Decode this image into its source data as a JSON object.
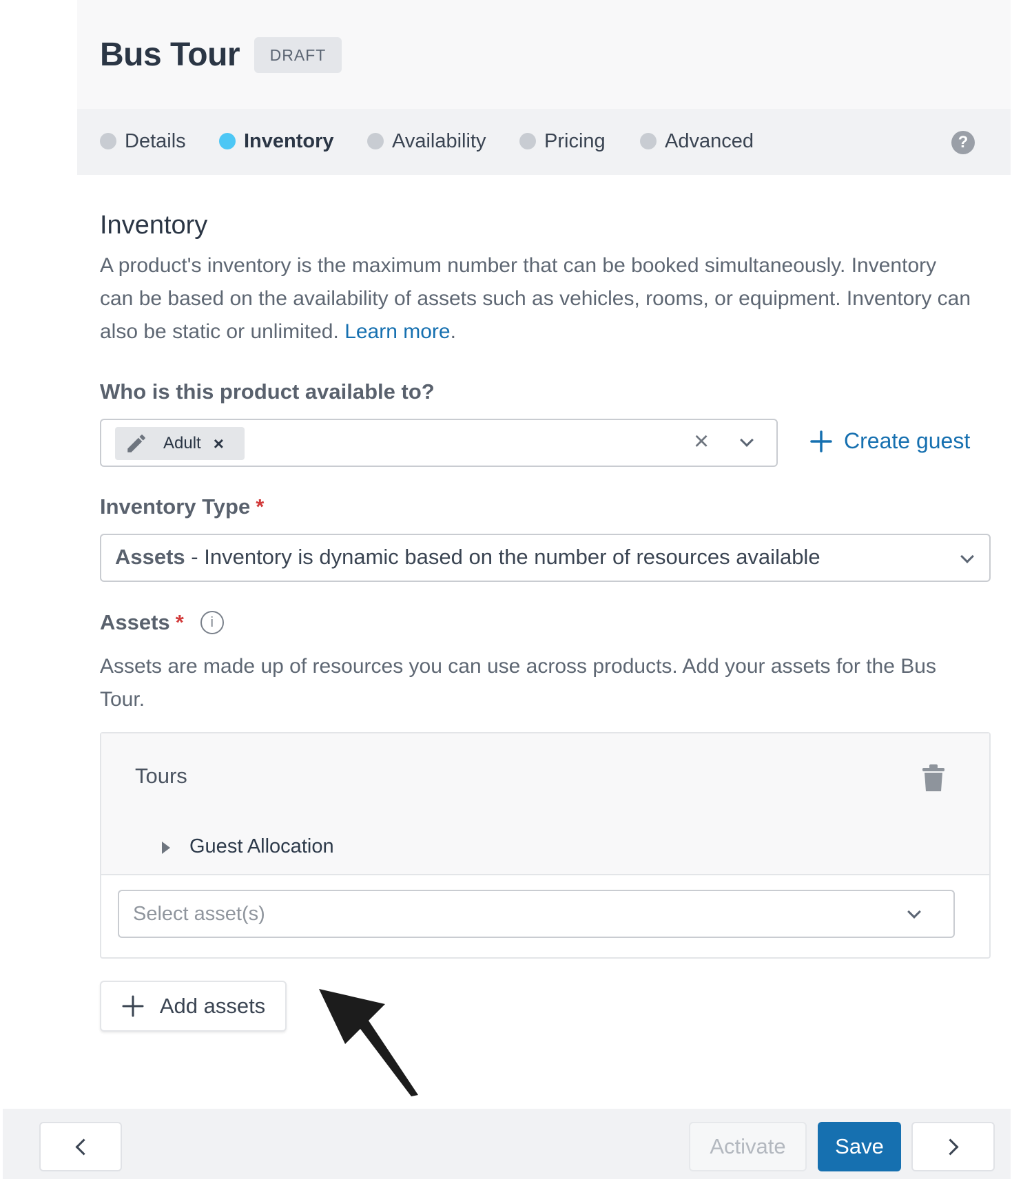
{
  "header": {
    "title": "Bus Tour",
    "status_badge": "DRAFT"
  },
  "tabs": [
    {
      "label": "Details",
      "active": false
    },
    {
      "label": "Inventory",
      "active": true
    },
    {
      "label": "Availability",
      "active": false
    },
    {
      "label": "Pricing",
      "active": false
    },
    {
      "label": "Advanced",
      "active": false
    }
  ],
  "help_icon": "?",
  "inventory": {
    "title": "Inventory",
    "description": "A product's inventory is the maximum number that can be booked simultaneously. Inventory can be based on the availability of assets such as vehicles, rooms, or equipment. Inventory can also be static or unlimited.",
    "learn_more": "Learn more",
    "period": "."
  },
  "availability": {
    "label": "Who is this product available to?",
    "chip": "Adult",
    "chip_remove": "×",
    "clear": "×",
    "create_guest": "Create guest"
  },
  "inventory_type": {
    "label": "Inventory Type",
    "required": "*",
    "value_bold": "Assets",
    "value_rest": " - Inventory is dynamic based on the number of resources available"
  },
  "assets": {
    "label": "Assets",
    "required": "*",
    "info_icon": "i",
    "description": "Assets are made up of resources you can use across products. Add your assets for the Bus Tour.",
    "card": {
      "name": "Tours",
      "guest_allocation": "Guest Allocation",
      "select_placeholder": "Select asset(s)"
    },
    "add_button": "Add assets"
  },
  "footer": {
    "activate": "Activate",
    "save": "Save"
  },
  "colors": {
    "accent": "#1670b0",
    "active_dot": "#4dc7f5",
    "required": "#d23b3b"
  }
}
